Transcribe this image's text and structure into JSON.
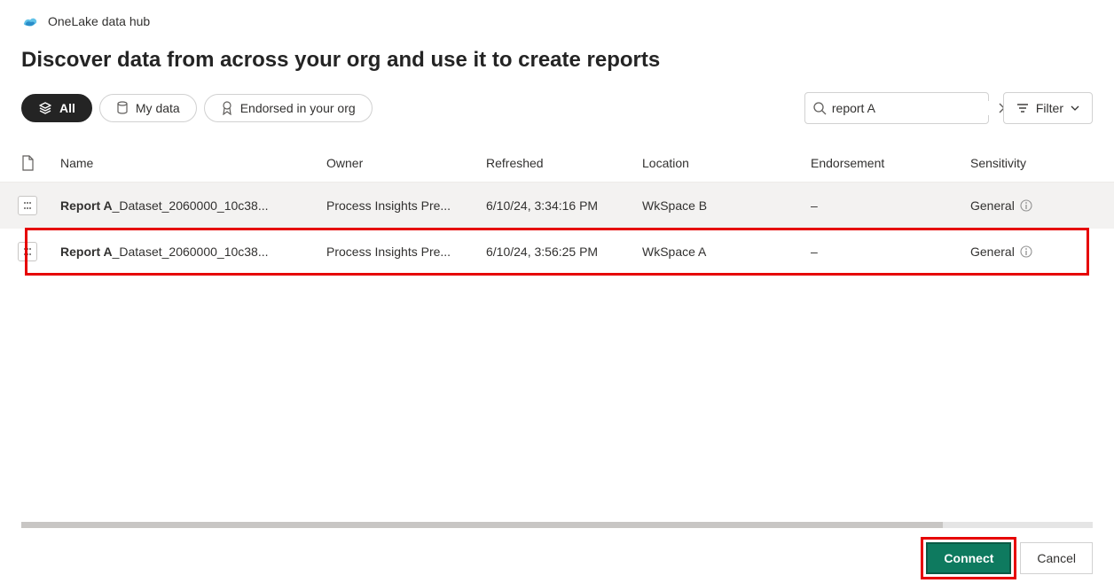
{
  "header": {
    "hub_title": "OneLake data hub",
    "page_title": "Discover data from across your org and use it to create reports"
  },
  "tabs": {
    "all": "All",
    "my_data": "My data",
    "endorsed": "Endorsed in your org"
  },
  "search": {
    "value": "report A"
  },
  "filter_label": "Filter",
  "columns": {
    "name": "Name",
    "owner": "Owner",
    "refreshed": "Refreshed",
    "location": "Location",
    "endorsement": "Endorsement",
    "sensitivity": "Sensitivity"
  },
  "rows": [
    {
      "name_bold": "Report A",
      "name_rest": "_Dataset_2060000_10c38...",
      "owner": "Process Insights Pre...",
      "refreshed": "6/10/24, 3:34:16 PM",
      "location": "WkSpace B",
      "endorsement": "–",
      "sensitivity": "General"
    },
    {
      "name_bold": "Report A",
      "name_rest": "_Dataset_2060000_10c38...",
      "owner": "Process Insights Pre...",
      "refreshed": "6/10/24, 3:56:25 PM",
      "location": "WkSpace A",
      "endorsement": "–",
      "sensitivity": "General"
    }
  ],
  "footer": {
    "connect": "Connect",
    "cancel": "Cancel"
  }
}
